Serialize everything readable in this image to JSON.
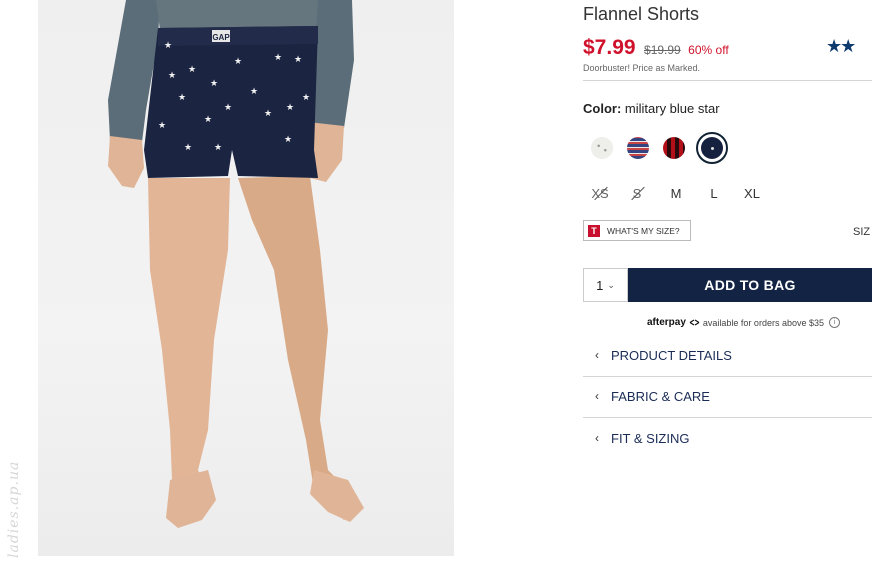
{
  "watermark": "ladies.ap.ua",
  "product": {
    "title": "Flannel Shorts",
    "price_now": "$7.99",
    "price_was": "$19.99",
    "discount": "60% off",
    "note": "Doorbuster! Price as Marked.",
    "rating_stars": "★★",
    "color_label": "Color:",
    "color_value": "military blue star",
    "waistband_logo": "GAP"
  },
  "swatches": [
    {
      "name": "cream star",
      "color": "#eeeeea",
      "selected": false
    },
    {
      "name": "red blue plaid",
      "color": "#3d4a86",
      "selected": false
    },
    {
      "name": "red black buffalo plaid",
      "color": "#c2101c",
      "selected": false
    },
    {
      "name": "military blue star",
      "color": "#15213e",
      "selected": true
    }
  ],
  "sizes": [
    {
      "label": "XS",
      "available": false
    },
    {
      "label": "S",
      "available": false
    },
    {
      "label": "M",
      "available": true
    },
    {
      "label": "L",
      "available": true
    },
    {
      "label": "XL",
      "available": true
    }
  ],
  "fit": {
    "icon_letter": "T",
    "whats_my_size": "WHAT'S MY SIZE?",
    "size_chart_partial": "SIZ"
  },
  "cart": {
    "quantity": "1",
    "add_to_bag": "ADD TO BAG"
  },
  "afterpay": {
    "brand": "afterpay",
    "text": "available for orders above $35",
    "info": "i"
  },
  "accordions": [
    {
      "label": "PRODUCT DETAILS"
    },
    {
      "label": "FABRIC & CARE"
    },
    {
      "label": "FIT & SIZING"
    }
  ],
  "colors": {
    "sale_red": "#d0112b",
    "navy_button": "#122344",
    "accordion_text": "#1a2c55",
    "short_fabric": "#1b2441"
  }
}
